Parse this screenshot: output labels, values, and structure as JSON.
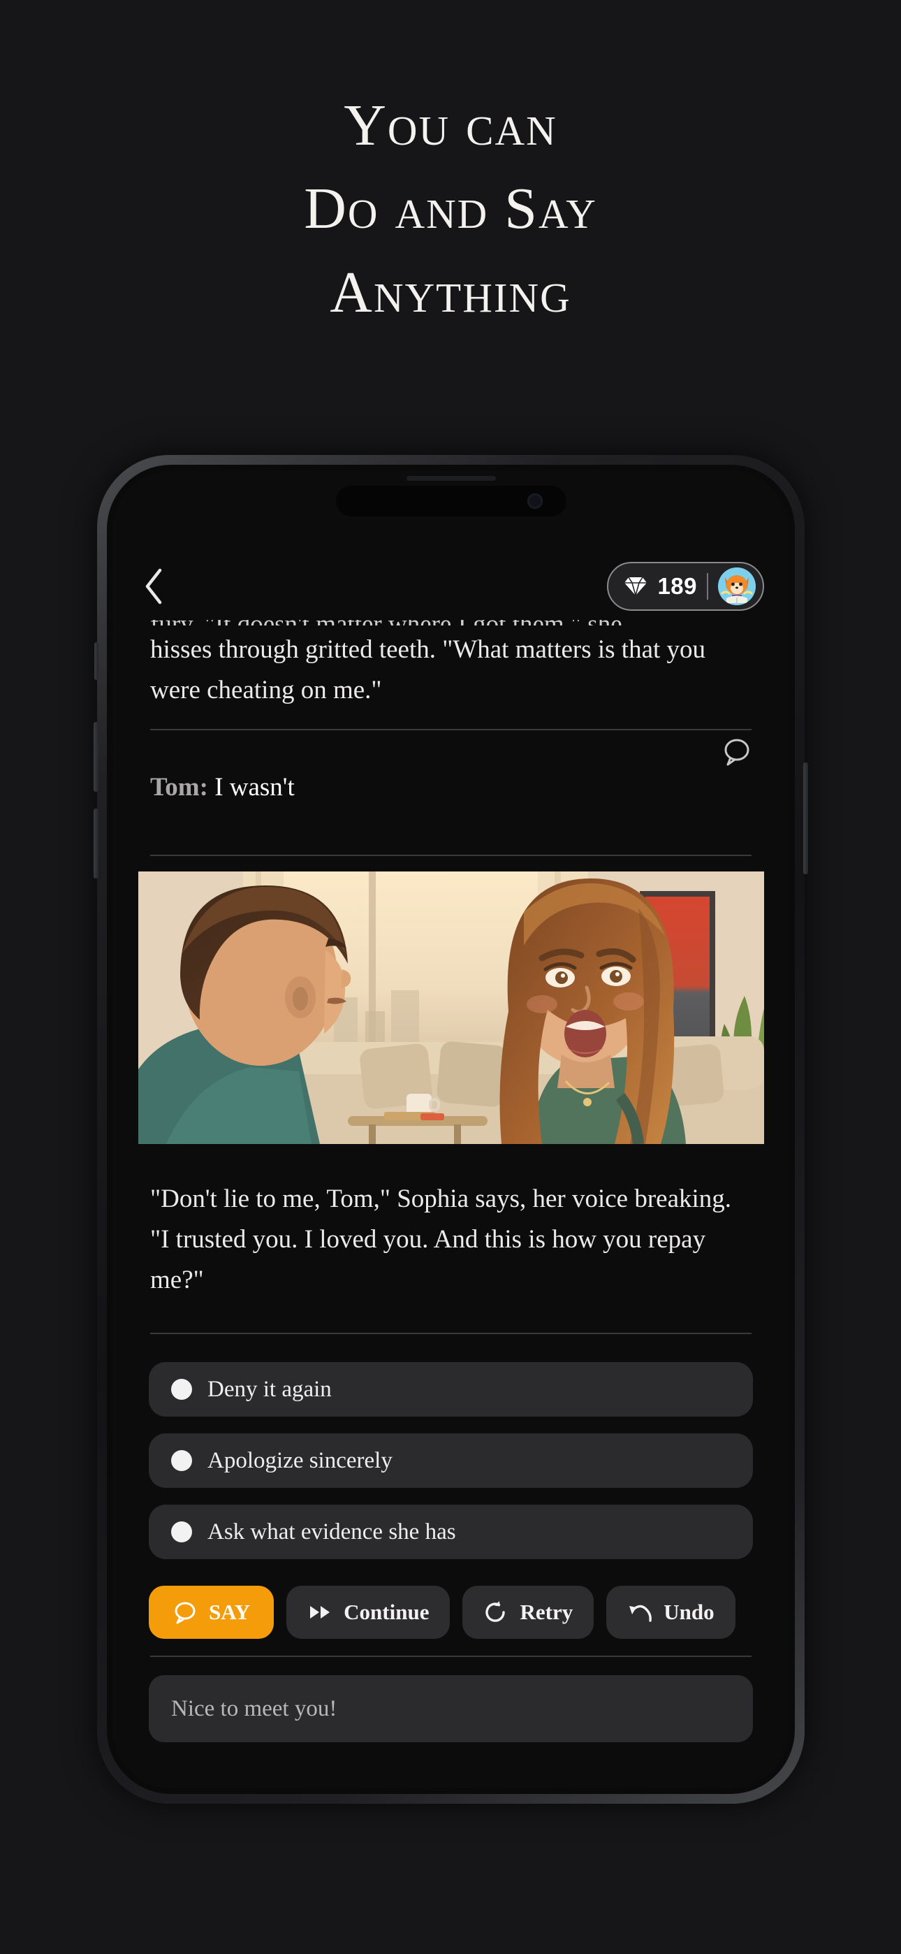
{
  "promo": {
    "headline_lines": [
      "You can",
      "Do and Say",
      "Anything"
    ]
  },
  "app": {
    "topbar": {
      "back_icon": "chevron-left-icon",
      "gem_icon": "diamond-icon",
      "gem_count": "189",
      "avatar_icon": "fox-reading-avatar"
    },
    "story": {
      "previous_paragraph_clipped": "fury. \"It doesn't matter where I got them,\" she",
      "previous_paragraph_rest": "hisses through gritted teeth. \"What matters is that you were cheating on me.\"",
      "reply_speaker": "Tom:",
      "reply_text": "I wasn't",
      "reply_bubble_icon": "speech-bubble-icon",
      "illustration_alt": "Tom and Sophia arguing in a sunlit living room",
      "narration": "\"Don't lie to me, Tom,\" Sophia says, her voice breaking. \"I trusted you. I loved you. And this is how you repay me?\""
    },
    "choices": [
      {
        "label": "Deny it again"
      },
      {
        "label": "Apologize sincerely"
      },
      {
        "label": "Ask what evidence she has"
      }
    ],
    "actions": [
      {
        "label": "SAY",
        "icon": "speech-bubble-icon",
        "primary": true
      },
      {
        "label": "Continue",
        "icon": "fast-forward-icon",
        "primary": false
      },
      {
        "label": "Retry",
        "icon": "refresh-icon",
        "primary": false
      },
      {
        "label": "Undo",
        "icon": "undo-arrow-icon",
        "primary": false
      }
    ],
    "input": {
      "value": "",
      "placeholder": "Nice to meet you!"
    }
  },
  "colors": {
    "background": "#161618",
    "accent": "#f59c0b",
    "surface": "#2b2b2d",
    "text": "#eceaea"
  }
}
